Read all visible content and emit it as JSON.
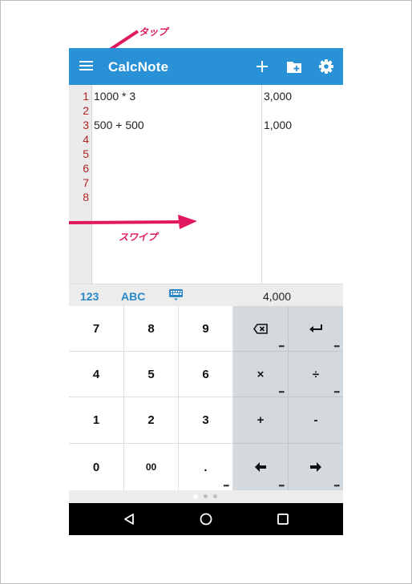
{
  "annotations": {
    "tap": "タップ",
    "swipe": "スワイプ"
  },
  "app": {
    "title": "CalcNote"
  },
  "editor": {
    "line_numbers": [
      "1",
      "2",
      "3",
      "4",
      "5",
      "6",
      "7",
      "8"
    ],
    "expressions": [
      "1000 * 3",
      "",
      "500 + 500",
      "",
      "",
      "",
      "",
      ""
    ],
    "results": [
      "3,000",
      "",
      "1,000",
      "",
      "",
      "",
      "",
      ""
    ]
  },
  "status": {
    "mode_numeric": "123",
    "mode_alpha": "ABC",
    "total": "4,000"
  },
  "keypad": {
    "rows": [
      [
        "7",
        "8",
        "9",
        "backspace",
        "enter"
      ],
      [
        "4",
        "5",
        "6",
        "×",
        "÷"
      ],
      [
        "1",
        "2",
        "3",
        "+",
        "-"
      ],
      [
        "0",
        "00",
        ".",
        "arrow-left",
        "arrow-right"
      ]
    ]
  },
  "pager": {
    "pages": 3,
    "active": 0
  },
  "colors": {
    "appbar": "#2991d6",
    "accent": "#2b86c5",
    "annotation": "#e0185f",
    "line_number": "#b22222"
  }
}
